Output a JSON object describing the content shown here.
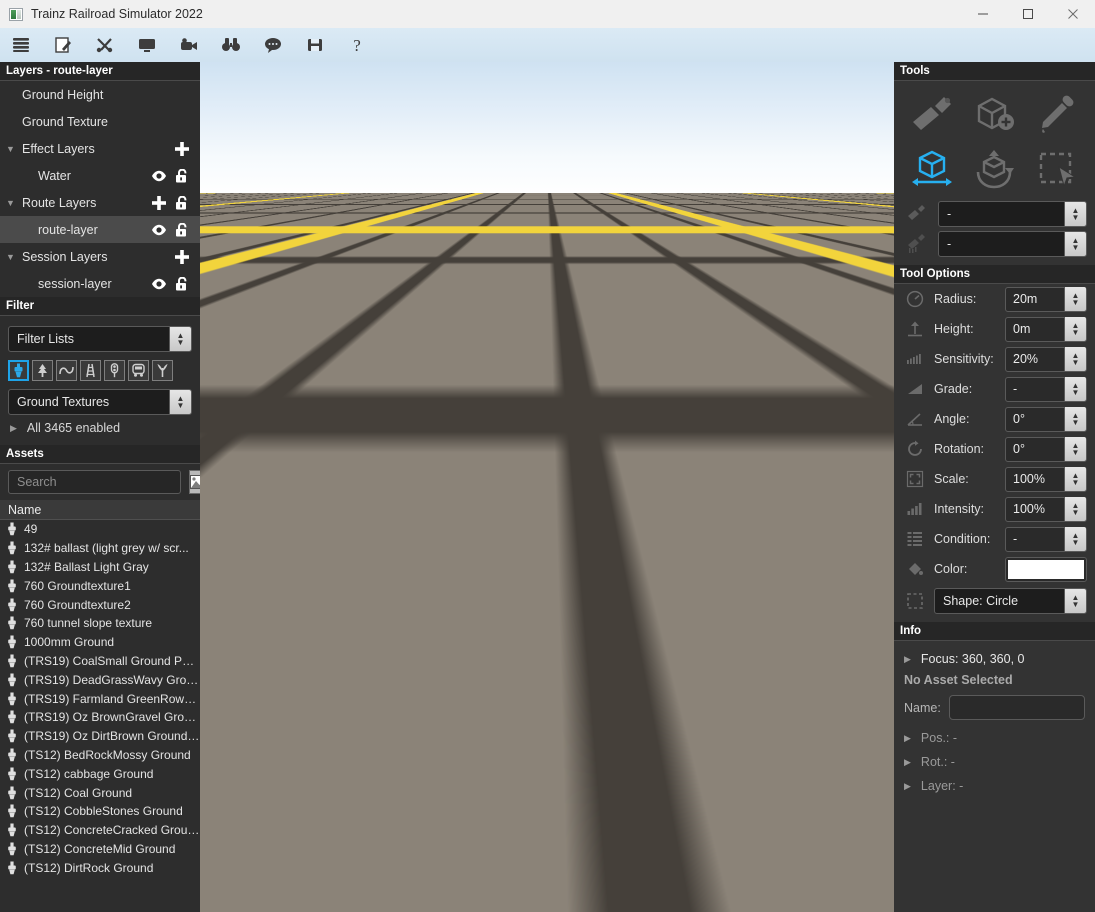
{
  "window": {
    "title": "Trainz Railroad Simulator 2022",
    "app_icon": "app-window-icon",
    "minimize": "minimize-icon",
    "maximize": "maximize-icon",
    "close": "close-icon"
  },
  "toolbar": {
    "buttons": [
      {
        "name": "menu-icon",
        "label": "Menu"
      },
      {
        "name": "edit-icon",
        "label": "Edit"
      },
      {
        "name": "tools-icon",
        "label": "Tools"
      },
      {
        "name": "display-icon",
        "label": "Display"
      },
      {
        "name": "camera-icon",
        "label": "Camera"
      },
      {
        "name": "binoculars-icon",
        "label": "Find"
      },
      {
        "name": "chat-icon",
        "label": "Chat"
      },
      {
        "name": "save-icon",
        "label": "Save"
      },
      {
        "name": "help-icon",
        "label": "Help"
      }
    ]
  },
  "layers": {
    "header": "Layers - route-layer",
    "rows": [
      {
        "label": "Ground Height",
        "indent": 0,
        "caret": "",
        "eye": false,
        "lock": false,
        "plus": false,
        "selected": false
      },
      {
        "label": "Ground Texture",
        "indent": 0,
        "caret": "",
        "eye": false,
        "lock": false,
        "plus": false,
        "selected": false
      },
      {
        "label": "Effect Layers",
        "indent": 0,
        "caret": "▼",
        "eye": false,
        "lock": false,
        "plus": true,
        "selected": false
      },
      {
        "label": "Water",
        "indent": 1,
        "caret": "",
        "eye": true,
        "lock": true,
        "plus": false,
        "selected": false
      },
      {
        "label": "Route Layers",
        "indent": 0,
        "caret": "▼",
        "eye": false,
        "lock": true,
        "plus": true,
        "selected": false
      },
      {
        "label": "route-layer",
        "indent": 1,
        "caret": "",
        "eye": true,
        "lock": true,
        "plus": false,
        "selected": true
      },
      {
        "label": "Session Layers",
        "indent": 0,
        "caret": "▼",
        "eye": false,
        "lock": false,
        "plus": true,
        "selected": false
      },
      {
        "label": "session-layer",
        "indent": 1,
        "caret": "",
        "eye": true,
        "lock": true,
        "plus": false,
        "selected": false
      }
    ]
  },
  "filter": {
    "header": "Filter",
    "lists_dropdown": "Filter Lists",
    "category_icons": [
      {
        "name": "paintbrush-filter-icon",
        "active": true
      },
      {
        "name": "tree-filter-icon",
        "active": false
      },
      {
        "name": "spline-filter-icon",
        "active": false
      },
      {
        "name": "track-filter-icon",
        "active": false
      },
      {
        "name": "signal-filter-icon",
        "active": false
      },
      {
        "name": "train-filter-icon",
        "active": false
      },
      {
        "name": "grass-filter-icon",
        "active": false
      }
    ],
    "type_dropdown": "Ground Textures",
    "enabled_text": "All 3465 enabled",
    "enabled_caret": "▶"
  },
  "assets": {
    "header": "Assets",
    "search_placeholder": "Search",
    "search_value": "",
    "thumbnail_icon": "image-thumbnail-icon",
    "column_header": "Name",
    "items": [
      "49",
      "132# ballast (light grey w/ scr...",
      "132# Ballast Light Gray",
      "760 Groundtexture1",
      "760 Groundtexture2",
      "760 tunnel slope texture",
      "1000mm Ground",
      "(TRS19) CoalSmall Ground PB...",
      "(TRS19) DeadGrassWavy Grou...",
      "(TRS19) Farmland GreenRows ...",
      "(TRS19) Oz BrownGravel Grou...",
      "(TRS19) Oz DirtBrown Ground ...",
      "(TS12) BedRockMossy Ground",
      "(TS12) cabbage Ground",
      "(TS12) Coal Ground",
      "(TS12) CobbleStones Ground",
      "(TS12) ConcreteCracked Ground",
      "(TS12) ConcreteMid Ground",
      "(TS12) DirtRock Ground"
    ]
  },
  "tools": {
    "header": "Tools",
    "buttons": [
      {
        "name": "paintbrush-tool-icon",
        "active": false
      },
      {
        "name": "add-object-tool-icon",
        "active": false
      },
      {
        "name": "eyedropper-tool-icon",
        "active": false
      },
      {
        "name": "move-object-tool-icon",
        "active": true
      },
      {
        "name": "rotate-object-tool-icon",
        "active": false
      },
      {
        "name": "marquee-select-tool-icon",
        "active": false
      }
    ],
    "brush_value": "-",
    "texture_value": "-"
  },
  "tool_options": {
    "header": "Tool Options",
    "rows": [
      {
        "icon": "radius-icon",
        "label": "Radius:",
        "value": "20m"
      },
      {
        "icon": "height-icon",
        "label": "Height:",
        "value": "0m"
      },
      {
        "icon": "sensitivity-icon",
        "label": "Sensitivity:",
        "value": "20%"
      },
      {
        "icon": "grade-icon",
        "label": "Grade:",
        "value": "-"
      },
      {
        "icon": "angle-icon",
        "label": "Angle:",
        "value": "0°"
      },
      {
        "icon": "rotation-icon",
        "label": "Rotation:",
        "value": "0°"
      },
      {
        "icon": "scale-icon",
        "label": "Scale:",
        "value": "100%"
      },
      {
        "icon": "intensity-icon",
        "label": "Intensity:",
        "value": "100%"
      },
      {
        "icon": "condition-icon",
        "label": "Condition:",
        "value": "-"
      }
    ],
    "color_label": "Color:",
    "color_icon": "paint-bucket-icon",
    "color_value": "#ffffff",
    "shape_icon": "shape-icon",
    "shape_value": "Shape: Circle"
  },
  "info": {
    "header": "Info",
    "focus": "Focus: 360, 360, 0",
    "focus_caret": "▶",
    "no_asset": "No Asset Selected",
    "name_label": "Name:",
    "name_value": "",
    "rows": [
      {
        "caret": "▶",
        "text": "Pos.: -"
      },
      {
        "caret": "▶",
        "text": "Rot.: -"
      },
      {
        "caret": "▶",
        "text": "Layer: -"
      }
    ]
  },
  "viewport": {
    "name": "3d-route-viewport",
    "sky_top_color": "#cfe2f2",
    "ground_color": "#8b8378",
    "grid_major_color": "#f2d43c",
    "grid_minor_color": "#45403a"
  }
}
